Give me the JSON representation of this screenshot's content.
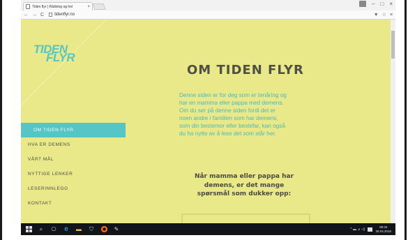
{
  "browser": {
    "tab_title": "Tiden flyr | Rådning og hel",
    "tab_close": "×",
    "window_buttons": {
      "profile": "",
      "minimize": "–",
      "maximize": "□",
      "close": "×"
    },
    "nav": {
      "back": "←",
      "forward": "→",
      "reload": "C"
    },
    "url": "tidenflyr.no",
    "toolbar_icons": {
      "extension": "▼",
      "bookmark": "☆",
      "menu": "≡"
    }
  },
  "site": {
    "logo": {
      "line1": "TIDEN",
      "line2": "FLYR"
    },
    "nav": [
      {
        "label": "OM TIDEN FLYR",
        "active": true
      },
      {
        "label": "HVA ER DEMENS",
        "active": false
      },
      {
        "label": "VÅRT MÅL",
        "active": false
      },
      {
        "label": "NYTTIGE LENKER",
        "active": false
      },
      {
        "label": "LESERINNLEGG",
        "active": false
      },
      {
        "label": "KONTAKT",
        "active": false
      }
    ],
    "heading": "OM TIDEN FLYR",
    "intro_lines": [
      "Denne siden er for deg som er tenåring og",
      "har en mamma eller pappa med demens.",
      "Om du ser på denne siden fordi det er",
      "noen andre i familien som har demens,",
      "som din bestemor eller bestefar, kan også",
      "du ha nytte av å lese det som står her."
    ],
    "subhead_lines": [
      "Når mamma eller pappa har",
      "demens, er det mange",
      "spørsmål som dukker opp:"
    ]
  },
  "taskbar": {
    "search_icon": "⌕",
    "taskview_icon": "⎔",
    "edge_icon": "e",
    "explorer_icon": "▬",
    "store_icon": "⛉",
    "paint_icon": "✎",
    "tray_icons": "^ ▬ ⊿ ◁)",
    "time": "08:34",
    "date": "28.04.2016"
  },
  "colors": {
    "page_background": "#e9e98a",
    "accent": "#55c5c6",
    "heading": "#4f4f48",
    "intro_text": "#4fb6b6"
  }
}
